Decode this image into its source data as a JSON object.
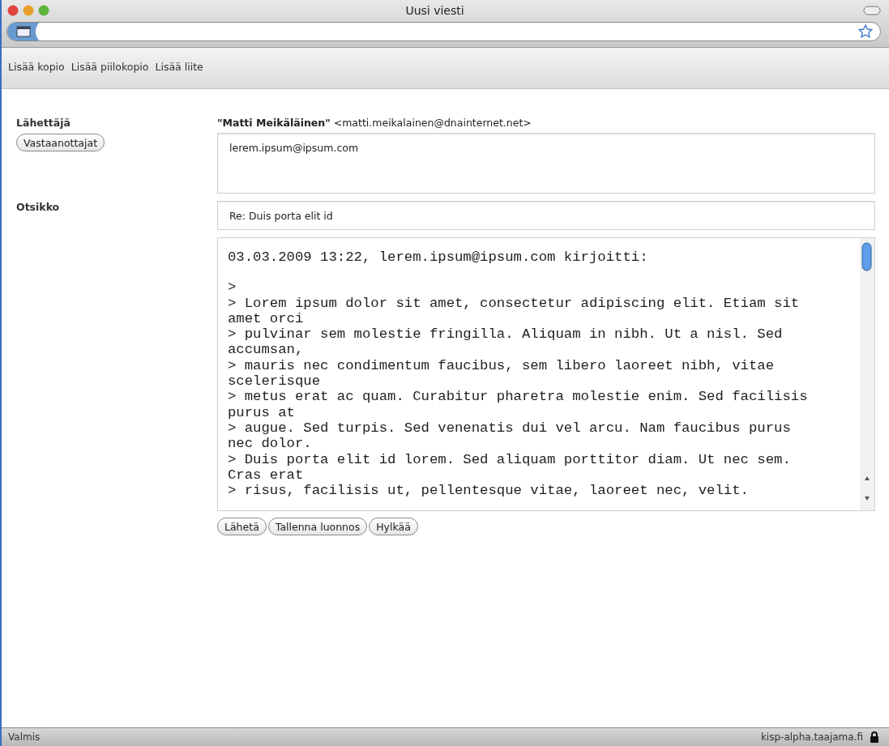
{
  "window": {
    "title": "Uusi viesti"
  },
  "toolbar": {
    "links": [
      "Lisää kopio",
      "Lisää piilokopio",
      "Lisää liite"
    ]
  },
  "form": {
    "sender_label": "Lähettäjä",
    "sender_name": "\"Matti Meikäläinen\"",
    "sender_address": "<matti.meikalainen@dnainternet.net>",
    "recipients_button": "Vastaanottajat",
    "recipients_value": "lerem.ipsum@ipsum.com",
    "subject_label": "Otsikko",
    "subject_value": "Re: Duis porta elit id",
    "body_attribution": "03.03.2009 13:22, lerem.ipsum@ipsum.com kirjoitti:",
    "body_lines": [
      ">",
      "> Lorem ipsum dolor sit amet, consectetur adipiscing elit. Etiam sit",
      "amet orci",
      "> pulvinar sem molestie fringilla. Aliquam in nibh. Ut a nisl. Sed",
      "accumsan,",
      "> mauris nec condimentum faucibus, sem libero laoreet nibh, vitae",
      "scelerisque",
      "> metus erat ac quam. Curabitur pharetra molestie enim. Sed facilisis",
      "purus at",
      "> augue. Sed turpis. Sed venenatis dui vel arcu. Nam faucibus purus",
      "nec dolor.",
      "> Duis porta elit id lorem. Sed aliquam porttitor diam. Ut nec sem.",
      "Cras erat",
      "> risus, facilisis ut, pellentesque vitae, laoreet nec, velit."
    ],
    "buttons": [
      "Lähetä",
      "Tallenna luonnos",
      "Hylkää"
    ]
  },
  "status_bar": {
    "text": "Valmis",
    "host": "kisp-alpha.taajama.fi"
  }
}
